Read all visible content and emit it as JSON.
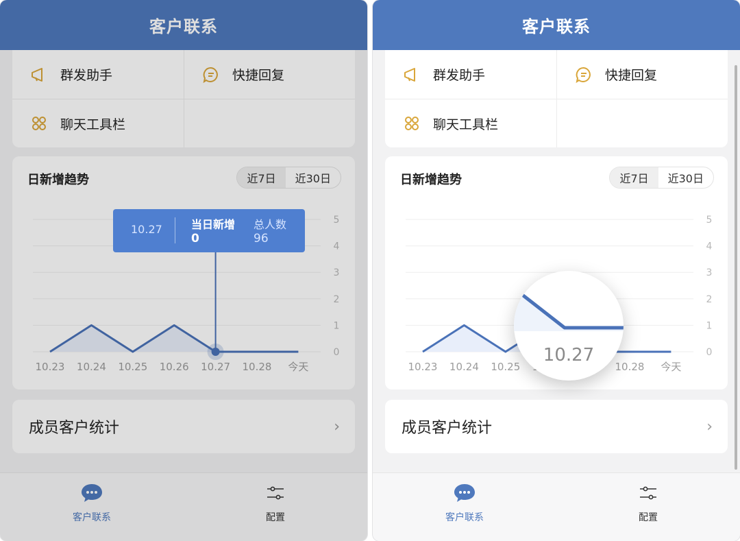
{
  "header": {
    "title": "客户联系"
  },
  "menu": {
    "items": [
      {
        "label": "群发助手",
        "icon": "megaphone-icon"
      },
      {
        "label": "快捷回复",
        "icon": "message-icon"
      },
      {
        "label": "聊天工具栏",
        "icon": "toolbar-grid-icon"
      }
    ]
  },
  "trend": {
    "title": "日新增趋势",
    "range_options": [
      "近7日",
      "近30日"
    ],
    "selected_range": "近7日"
  },
  "chart_data": {
    "type": "area",
    "title": "日新增趋势",
    "categories": [
      "10.23",
      "10.24",
      "10.25",
      "10.26",
      "10.27",
      "10.28",
      "今天"
    ],
    "series": [
      {
        "values": [
          0,
          1,
          0,
          1,
          0,
          0,
          0
        ]
      }
    ],
    "ylim": [
      0,
      5
    ],
    "y_ticks": [
      "0",
      "1",
      "2",
      "3",
      "4",
      "5"
    ],
    "y_axis_side": "right",
    "grid": true
  },
  "tooltip": {
    "date": "10.27",
    "new_label": "当日新增",
    "new_value": "0",
    "total_label": "总人数",
    "total_value": "96"
  },
  "magnifier": {
    "label": "10.27"
  },
  "member_stats": {
    "label": "成员客户统计",
    "chevron": "›"
  },
  "tabbar": {
    "items": [
      {
        "label": "客户联系",
        "icon": "chat-bubble-icon",
        "active": true
      },
      {
        "label": "配置",
        "icon": "sliders-icon",
        "active": false
      }
    ]
  },
  "colors": {
    "brand": "#4f79bd",
    "line": "#4a72b8",
    "area": "#e8eefa",
    "tooltip": "#4f7fd0",
    "icon_gold": "#d9a63a"
  }
}
